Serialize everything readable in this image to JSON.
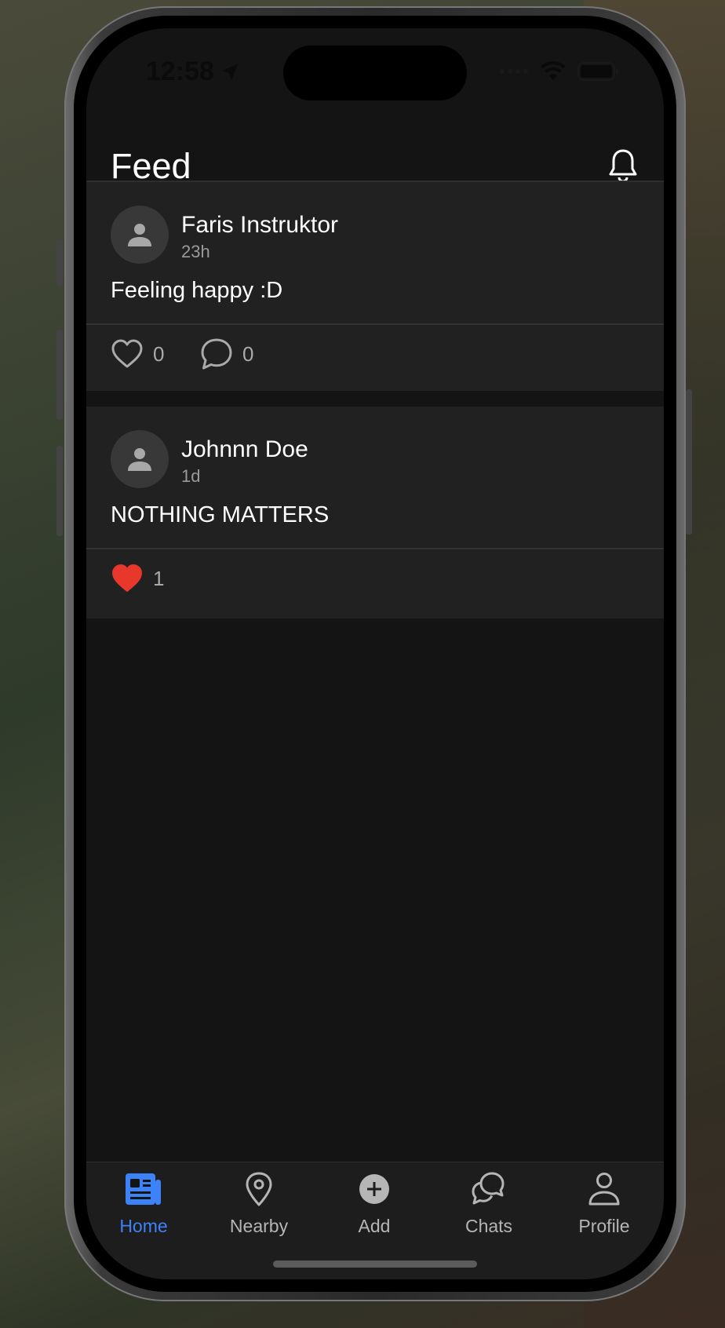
{
  "status_bar": {
    "time": "12:58"
  },
  "header": {
    "title": "Feed"
  },
  "posts": [
    {
      "author": "Faris Instruktor",
      "time": "23h",
      "content": "Feeling happy :D",
      "likes": "0",
      "comments": "0",
      "liked": false
    },
    {
      "author": "Johnnn Doe",
      "time": "1d",
      "content": "NOTHING MATTERS",
      "likes": "1",
      "liked": true
    }
  ],
  "tabbar": {
    "tabs": [
      {
        "label": "Home",
        "icon": "newspaper-icon",
        "active": true
      },
      {
        "label": "Nearby",
        "icon": "location-pin-icon",
        "active": false
      },
      {
        "label": "Add",
        "icon": "add-circle-icon",
        "active": false
      },
      {
        "label": "Chats",
        "icon": "chat-bubbles-icon",
        "active": false
      },
      {
        "label": "Profile",
        "icon": "person-icon",
        "active": false
      }
    ]
  },
  "colors": {
    "accent": "#3e82f7",
    "like_red": "#e8372b",
    "background": "#141414",
    "card": "#212121"
  }
}
